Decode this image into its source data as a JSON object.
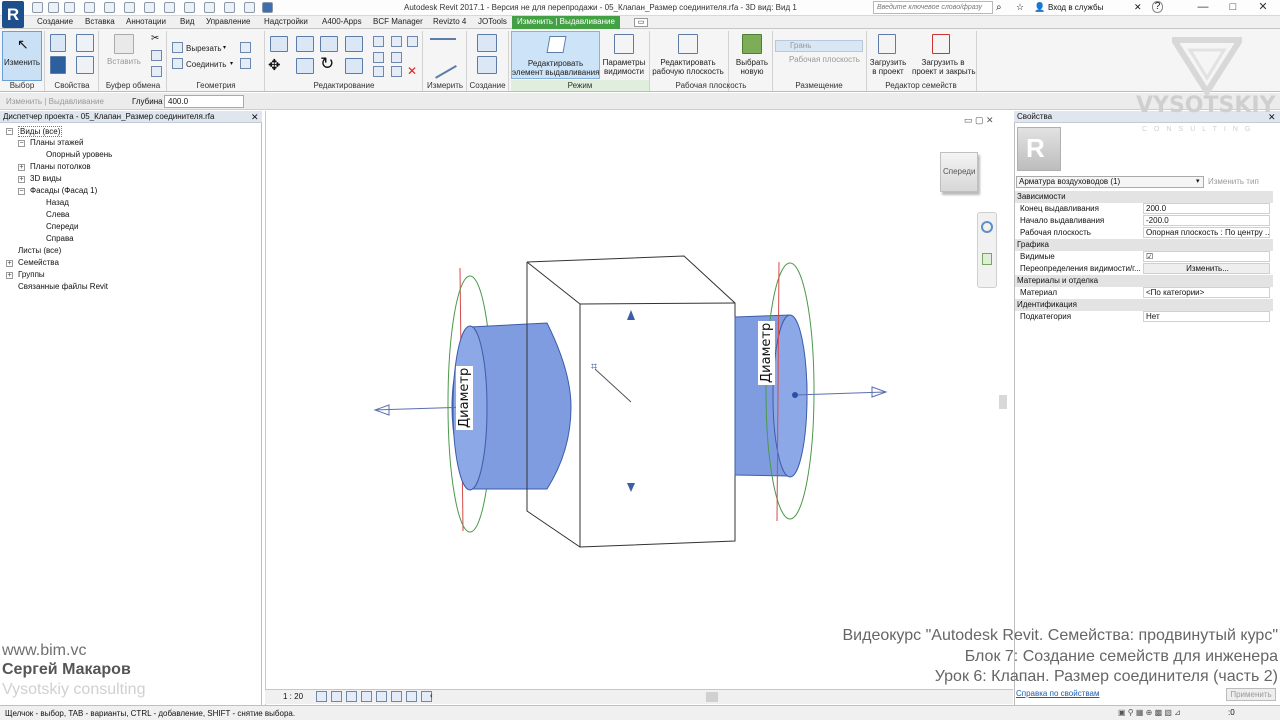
{
  "titlebar": {
    "logo": "R",
    "title": "Autodesk Revit 2017.1 - Версия не для перепродажи -    05_Клапан_Размер соединителя.rfa - 3D вид: Вид 1",
    "search_placeholder": "Введите ключевое слово/фразу",
    "login": "Вход в службы",
    "help": "?",
    "win_min": "—",
    "win_max": "□",
    "win_close": "✕"
  },
  "tabs": [
    "Создание",
    "Вставка",
    "Аннотации",
    "Вид",
    "Управление",
    "Надстройки",
    "A400-Apps",
    "BCF Manager",
    "Revizto 4",
    "JOTools"
  ],
  "active_tab": "Изменить | Выдавливание",
  "ribbon": {
    "modify": "Изменить",
    "properties_label": "Свойства",
    "paste": "Вставить",
    "cut": "Вырезать",
    "join": "Соединить",
    "edit_extrusion_line1": "Редактировать",
    "edit_extrusion_line2": "элемент выдавливания",
    "visibility_line1": "Параметры",
    "visibility_line2": "видимости",
    "workplane_edit_line1": "Редактировать",
    "workplane_edit_line2": "рабочую плоскость",
    "pick_new_line1": "Выбрать",
    "pick_new_line2": "новую",
    "face": "Грань",
    "work_plane": "Рабочая плоскость",
    "load_line1": "Загрузить",
    "load_line2": "в проект",
    "load_close_line1": "Загрузить в",
    "load_close_line2": "проект и закрыть",
    "groups": {
      "select": "Выбор",
      "properties": "Свойства",
      "clipboard": "Буфер обмена",
      "geometry": "Геометрия",
      "modify": "Редактирование",
      "measure": "Измерить",
      "create": "Создание",
      "mode": "Режим",
      "workplane": "Рабочая плоскость",
      "placement": "Размещение",
      "family_editor": "Редактор семейств"
    }
  },
  "options_bar": {
    "context": "Изменить | Выдавливание",
    "depth_label": "Глубина",
    "depth_value": "400.0"
  },
  "project_browser": {
    "header": "Диспетчер проекта - 05_Клапан_Размер соединителя.rfa",
    "items": [
      {
        "label": "Виды (все)",
        "toggle": "−"
      },
      {
        "label": "Планы этажей",
        "toggle": "−"
      },
      {
        "label": "Опорный уровень",
        "toggle": ""
      },
      {
        "label": "Планы потолков",
        "toggle": "+"
      },
      {
        "label": "3D виды",
        "toggle": "+"
      },
      {
        "label": "Фасады (Фасад 1)",
        "toggle": "−"
      },
      {
        "label": "Назад",
        "toggle": ""
      },
      {
        "label": "Слева",
        "toggle": ""
      },
      {
        "label": "Спереди",
        "toggle": ""
      },
      {
        "label": "Справа",
        "toggle": ""
      },
      {
        "label": "Листы (все)",
        "toggle": ""
      },
      {
        "label": "Семейства",
        "toggle": "+"
      },
      {
        "label": "Группы",
        "toggle": "+"
      },
      {
        "label": "Связанные файлы Revit",
        "toggle": ""
      }
    ]
  },
  "viewport": {
    "viewcube_label": "Спереди",
    "dim_left": "Диаметр",
    "dim_right": "Диаметр",
    "scale": "1 : 20"
  },
  "properties": {
    "header": "Свойства",
    "type_selector": "Арматура воздуховодов (1)",
    "edit_type": "Изменить тип",
    "rows": [
      {
        "name": "Зависимости",
        "value": "",
        "cat": true
      },
      {
        "name": "Конец выдавливания",
        "value": "200.0",
        "cat": false
      },
      {
        "name": "Начало выдавливания",
        "value": "-200.0",
        "cat": false
      },
      {
        "name": "Рабочая плоскость",
        "value": "Опорная плоскость : По центру ...",
        "cat": false
      },
      {
        "name": "Графика",
        "value": "",
        "cat": true
      },
      {
        "name": "Видимые",
        "value": "☑",
        "cat": false
      },
      {
        "name": "Переопределения видимости/г...",
        "value": "Изменить...",
        "cat": false
      },
      {
        "name": "Материалы и отделка",
        "value": "",
        "cat": true
      },
      {
        "name": "Материал",
        "value": "<По категории>",
        "cat": false
      },
      {
        "name": "Идентификация",
        "value": "",
        "cat": true
      },
      {
        "name": "Подкатегория",
        "value": "Нет",
        "cat": false
      }
    ],
    "help_link": "Справка по свойствам",
    "apply": "Применить"
  },
  "status_text": "Щелчок - выбор, TAB - варианты, CTRL - добавление, SHIFT - снятие выбора.",
  "status_right": ":0",
  "overlay": {
    "website": "www.bim.vc",
    "author": "Сергей Макаров",
    "company": "Vysotskiy consulting",
    "course_line1": "Видеокурс \"Autodesk Revit. Семейства: продвинутый курс\"",
    "course_line2": "Блок 7: Создание семейств для инженера",
    "course_line3": "Урок 6: Клапан. Размер соединителя (часть 2)",
    "watermark": "VYSOTSKIY",
    "watermark_sub": "CONSULTING"
  },
  "colors": {
    "accent_tab": "#44a045",
    "cylinder": "#7f9ce0",
    "ribbon_bg": "#f5f5f5"
  }
}
